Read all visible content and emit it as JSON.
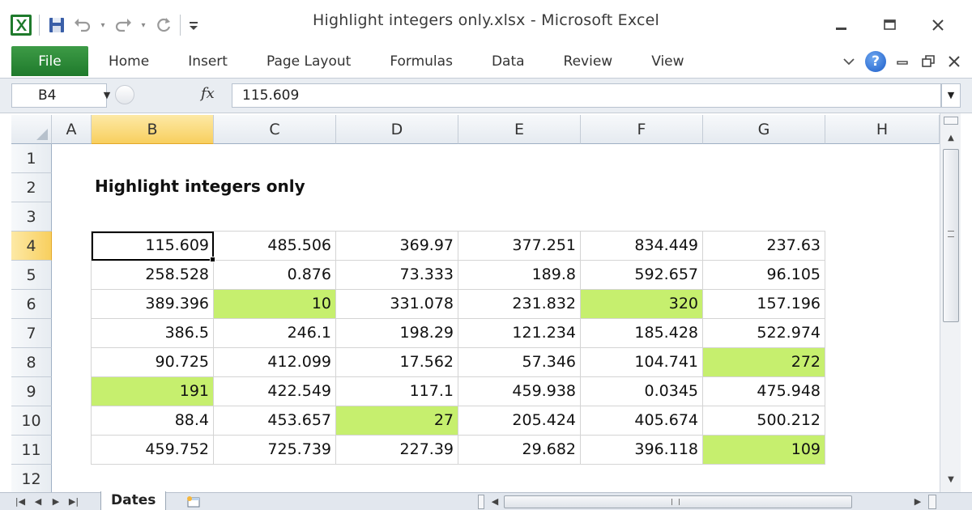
{
  "window": {
    "title": "Highlight integers only.xlsx  -  Microsoft Excel"
  },
  "ribbon": {
    "file_label": "File",
    "tabs": [
      "Home",
      "Insert",
      "Page Layout",
      "Formulas",
      "Data",
      "Review",
      "View"
    ],
    "help_label": "?"
  },
  "formula_bar": {
    "name_box": "B4",
    "fx_label": "fx",
    "value": "115.609"
  },
  "sheet": {
    "title": "Highlight integers only",
    "columns": [
      "A",
      "B",
      "C",
      "D",
      "E",
      "F",
      "G",
      "H"
    ],
    "rows": [
      "1",
      "2",
      "3",
      "4",
      "5",
      "6",
      "7",
      "8",
      "9",
      "10",
      "11",
      "12"
    ],
    "selected_column": "B",
    "selected_row": "4",
    "highlight_color": "#c6ef6e",
    "data": [
      [
        "115.609",
        "485.506",
        "369.97",
        "377.251",
        "834.449",
        "237.63"
      ],
      [
        "258.528",
        "0.876",
        "73.333",
        "189.8",
        "592.657",
        "96.105"
      ],
      [
        "389.396",
        "10",
        "331.078",
        "231.832",
        "320",
        "157.196"
      ],
      [
        "386.5",
        "246.1",
        "198.29",
        "121.234",
        "185.428",
        "522.974"
      ],
      [
        "90.725",
        "412.099",
        "17.562",
        "57.346",
        "104.741",
        "272"
      ],
      [
        "191",
        "422.549",
        "117.1",
        "459.938",
        "0.0345",
        "475.948"
      ],
      [
        "88.4",
        "453.657",
        "27",
        "205.424",
        "405.674",
        "500.212"
      ],
      [
        "459.752",
        "725.739",
        "227.39",
        "29.682",
        "396.118",
        "109"
      ]
    ],
    "highlighted": [
      [
        2,
        1
      ],
      [
        2,
        4
      ],
      [
        4,
        5
      ],
      [
        5,
        0
      ],
      [
        6,
        2
      ],
      [
        7,
        5
      ]
    ]
  },
  "sheet_tabs": {
    "active": "Dates"
  }
}
